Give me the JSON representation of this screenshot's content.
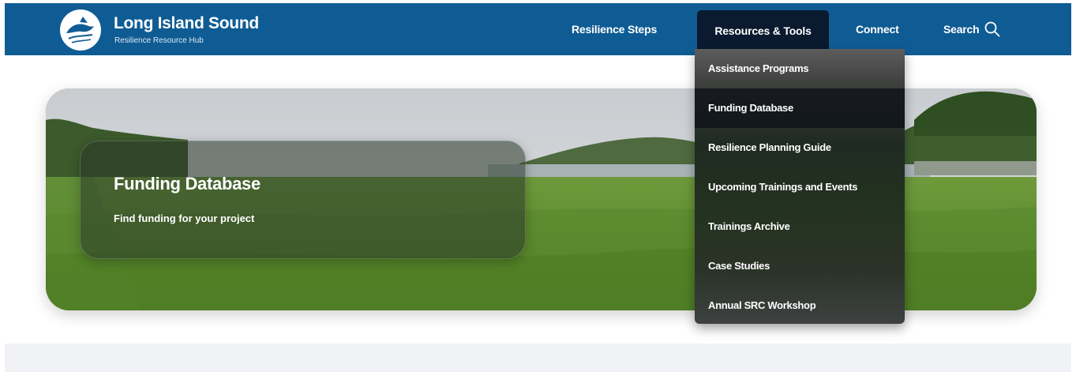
{
  "brand": {
    "title": "Long Island Sound",
    "subtitle": "Resilience Resource Hub"
  },
  "nav": {
    "items": [
      {
        "label": "Resilience Steps"
      },
      {
        "label": "Resources & Tools",
        "active": true
      },
      {
        "label": "Connect"
      },
      {
        "label": "Search",
        "icon": "search-icon"
      }
    ]
  },
  "dropdown": {
    "items": [
      {
        "label": "Assistance Programs"
      },
      {
        "label": "Funding Database",
        "active": true
      },
      {
        "label": "Resilience Planning Guide"
      },
      {
        "label": "Upcoming Trainings and Events"
      },
      {
        "label": "Trainings Archive"
      },
      {
        "label": "Case Studies"
      },
      {
        "label": "Annual SRC Workshop"
      }
    ]
  },
  "hero": {
    "title": "Funding Database",
    "subtitle": "Find funding for your project",
    "image": "salt-marsh-landscape"
  },
  "colors": {
    "header": "#0f5c94",
    "nav_active": "#0b1a2e",
    "footer_band": "#f1f2f5"
  }
}
